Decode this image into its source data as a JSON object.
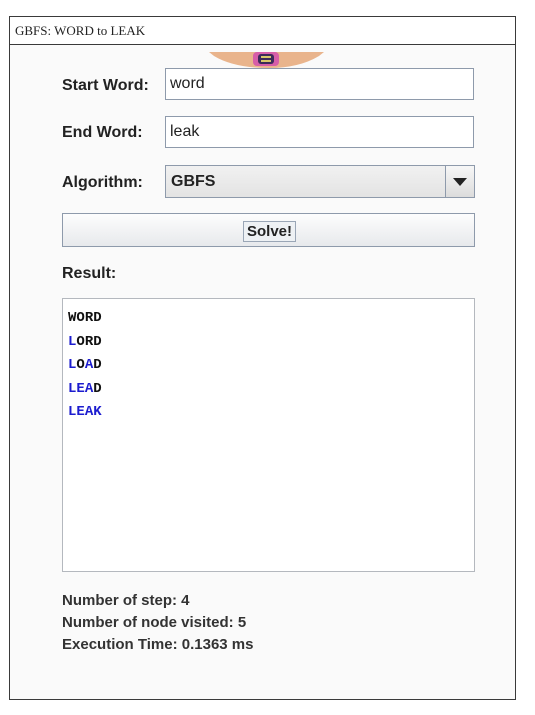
{
  "window": {
    "title": "GBFS: WORD to LEAK"
  },
  "form": {
    "start_label": "Start Word:",
    "start_value": "word",
    "end_label": "End Word:",
    "end_value": "leak",
    "algorithm_label": "Algorithm:",
    "algorithm_value": "GBFS",
    "solve_label": "Solve!"
  },
  "result": {
    "label": "Result:",
    "changed_color": "#1c1ccf",
    "lines": [
      {
        "text": "WORD",
        "changed": [
          0,
          0,
          0,
          0
        ]
      },
      {
        "text": "LORD",
        "changed": [
          1,
          0,
          0,
          0
        ]
      },
      {
        "text": "LOAD",
        "changed": [
          1,
          0,
          1,
          0
        ]
      },
      {
        "text": "LEAD",
        "changed": [
          1,
          1,
          1,
          0
        ]
      },
      {
        "text": "LEAK",
        "changed": [
          1,
          1,
          1,
          1
        ]
      }
    ]
  },
  "stats": {
    "steps": "Number of step: 4",
    "visited": "Number of node visited: 5",
    "time": "Execution Time: 0.1363 ms"
  }
}
